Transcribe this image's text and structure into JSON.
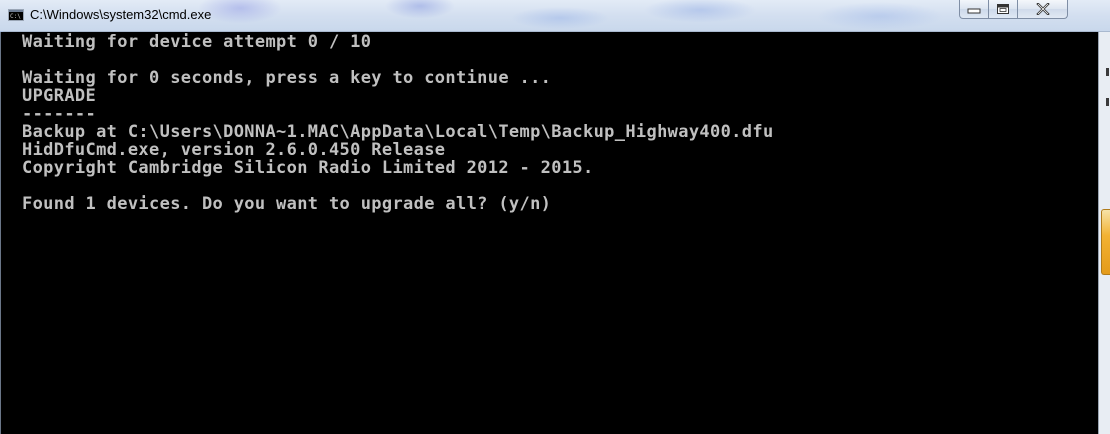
{
  "window": {
    "title": "C:\\Windows\\system32\\cmd.exe",
    "icon_text": "C:\\",
    "controls": [
      "minimize",
      "maximize",
      "close"
    ]
  },
  "console": {
    "background": "#000000",
    "foreground": "#c0c0c0",
    "lines": [
      "Waiting for device attempt 0 / 10",
      "",
      "Waiting for 0 seconds, press a key to continue ...",
      "UPGRADE",
      "-------",
      "Backup at C:\\Users\\DONNA~1.MAC\\AppData\\Local\\Temp\\Backup_Highway400.dfu",
      "HidDfuCmd.exe, version 2.6.0.450 Release",
      "Copyright Cambridge Silicon Radio Limited 2012 - 2015.",
      "",
      "Found 1 devices. Do you want to upgrade all? (y/n)"
    ]
  },
  "icons": {
    "app": "console-icon",
    "minimize": "minimize-icon",
    "maximize": "maximize-icon",
    "close": "close-icon"
  },
  "colors": {
    "accent_orange": "#f2b233"
  }
}
